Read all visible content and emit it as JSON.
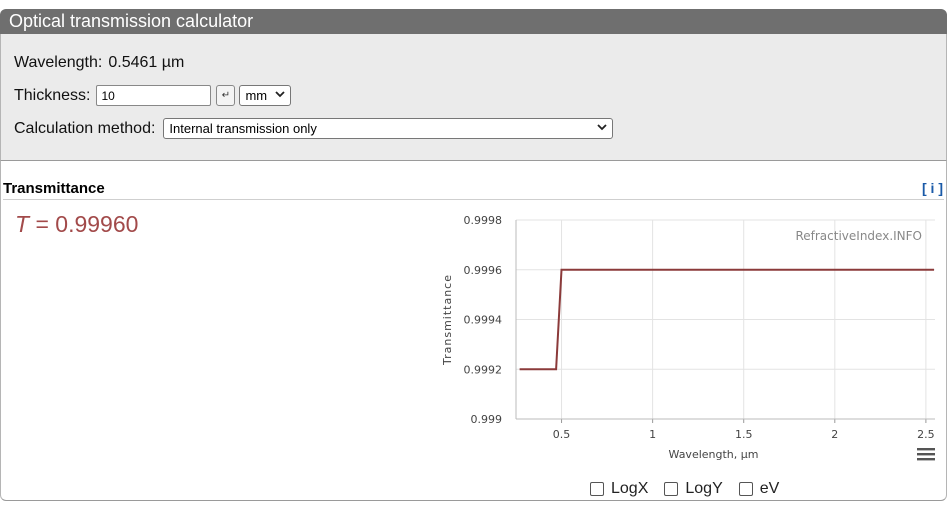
{
  "header": {
    "title": "Optical transmission calculator"
  },
  "settings": {
    "wavelength_label": "Wavelength:",
    "wavelength_value": "0.5461 µm",
    "thickness_label": "Thickness:",
    "thickness_value": "10",
    "enter_symbol": "↵",
    "thickness_unit": "mm",
    "method_label": "Calculation method:",
    "method_value": "Internal transmission only"
  },
  "results": {
    "title": "Transmittance",
    "info_label": "[ i ]",
    "value_symbol": "T",
    "value_text": " = 0.99960"
  },
  "chart_data": {
    "type": "line",
    "title": "",
    "watermark": "RefractiveIndex.INFO",
    "xlabel": "Wavelength, µm",
    "ylabel": "Transmittance",
    "xlim": [
      0.25,
      2.55
    ],
    "ylim": [
      0.999,
      0.9998
    ],
    "xticks": [
      0.5,
      1,
      1.5,
      2,
      2.5
    ],
    "xtick_labels": [
      "0.5",
      "1",
      "1.5",
      "2",
      "2.5"
    ],
    "yticks": [
      0.999,
      0.9992,
      0.9994,
      0.9996,
      0.9998
    ],
    "ytick_labels": [
      "0.999",
      "0.9992",
      "0.9994",
      "0.9996",
      "0.9998"
    ],
    "grid": true,
    "line_color": "#8b3a3a",
    "series": [
      {
        "x": [
          0.27,
          0.47,
          0.5,
          2.55
        ],
        "y": [
          0.9992,
          0.9992,
          0.9996,
          0.9996
        ]
      }
    ]
  },
  "toggles": [
    {
      "label": "LogX",
      "checked": false
    },
    {
      "label": "LogY",
      "checked": false
    },
    {
      "label": "eV",
      "checked": false
    }
  ],
  "icons": {
    "menu": "hamburger-menu-icon",
    "select": "chevron-down-icon"
  }
}
